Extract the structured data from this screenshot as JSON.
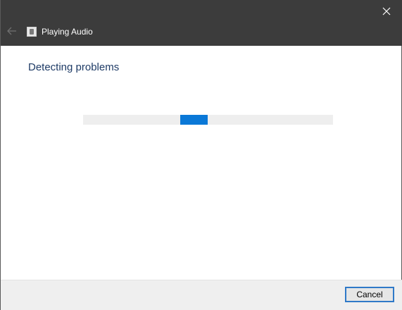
{
  "window": {
    "title": "Playing Audio",
    "close_icon": "close-icon",
    "back_icon": "back-arrow-icon",
    "app_icon": "troubleshooter-icon",
    "titlebar_color": "#3c3c3c"
  },
  "main": {
    "heading": "Detecting problems",
    "progress": {
      "indeterminate": true,
      "fill_fraction": 0.11,
      "accent_color": "#0a78d7"
    }
  },
  "footer": {
    "cancel_label": "Cancel"
  }
}
